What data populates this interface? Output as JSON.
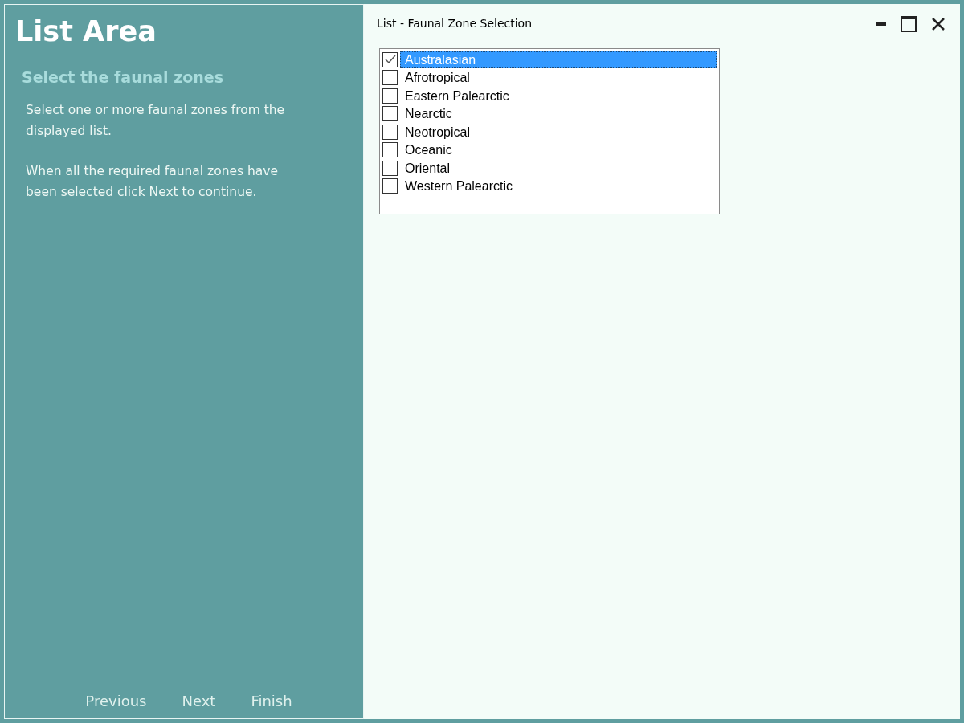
{
  "sidebar": {
    "title": "List Area",
    "subtitle": "Select the faunal zones",
    "paragraphs": [
      "Select one or more faunal zones from the displayed list.",
      "When all the required faunal zones have been selected click Next to continue."
    ],
    "buttons": [
      "Previous",
      "Next",
      "Finish"
    ]
  },
  "window": {
    "title": "List - Faunal Zone Selection"
  },
  "list": {
    "items": [
      {
        "label": "Australasian",
        "checked": true,
        "selected": true
      },
      {
        "label": "Afrotropical",
        "checked": false,
        "selected": false
      },
      {
        "label": "Eastern Palearctic",
        "checked": false,
        "selected": false
      },
      {
        "label": "Nearctic",
        "checked": false,
        "selected": false
      },
      {
        "label": "Neotropical",
        "checked": false,
        "selected": false
      },
      {
        "label": "Oceanic",
        "checked": false,
        "selected": false
      },
      {
        "label": "Oriental",
        "checked": false,
        "selected": false
      },
      {
        "label": "Western Palearctic",
        "checked": false,
        "selected": false
      }
    ]
  }
}
